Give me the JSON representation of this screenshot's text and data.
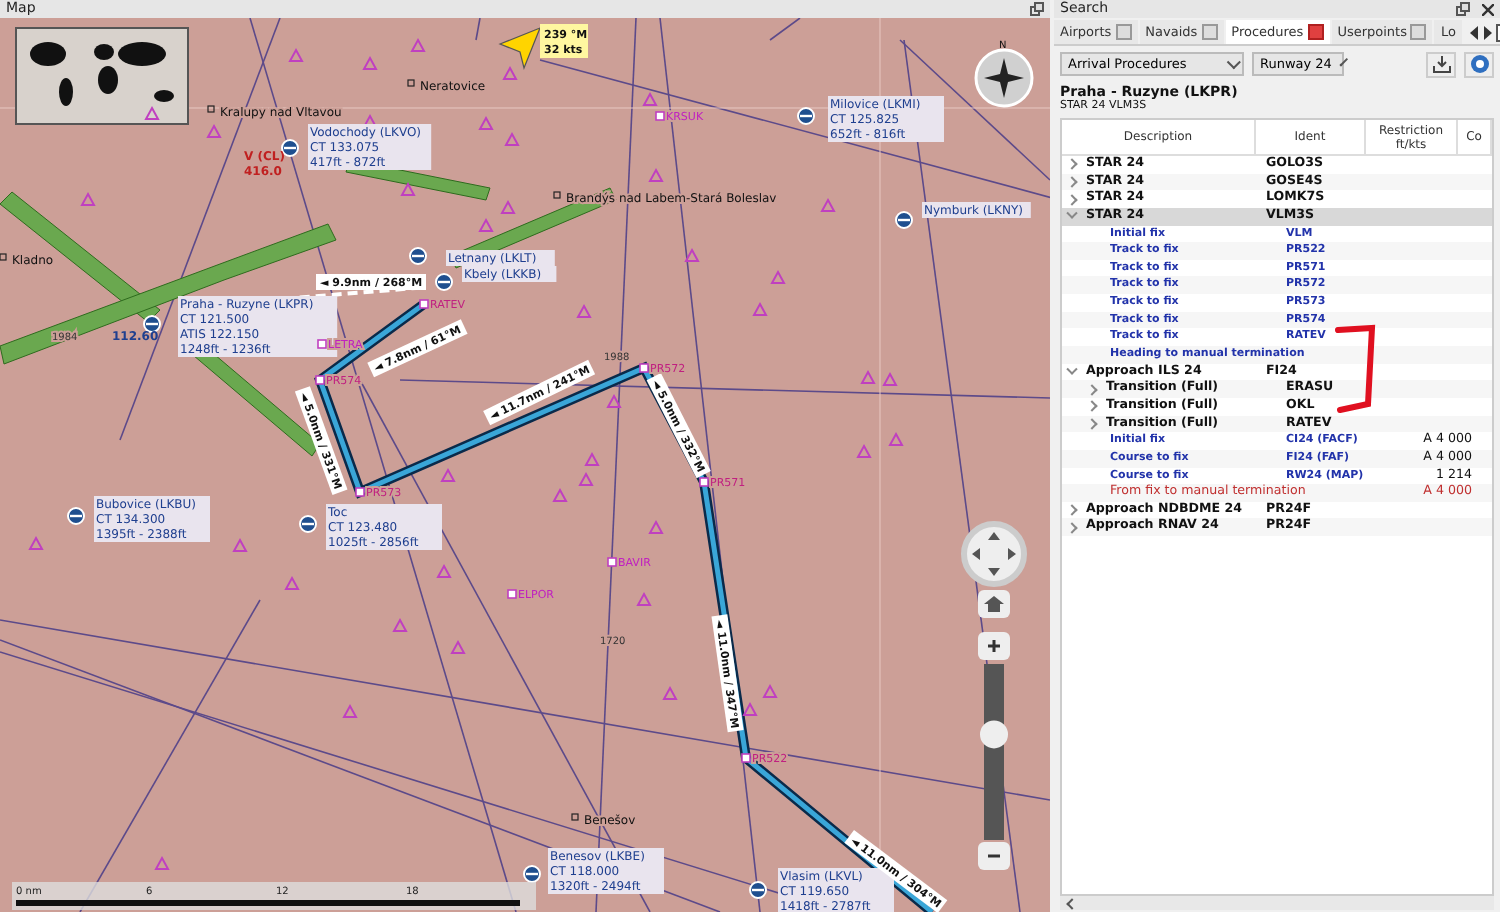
{
  "map": {
    "title": "Map",
    "aircraft": {
      "heading": "239 °M",
      "speed": "32 kts"
    },
    "places": [
      "Kralupy nad Vltavou",
      "Neratovice",
      "Kladno",
      "Brandýs nad Labem-Stará Boleslav",
      "Benešov"
    ],
    "airports": [
      {
        "name": "Vodochody (LKVO)",
        "lines": [
          "CT 133.075",
          "417ft - 872ft"
        ]
      },
      {
        "name": "Praha - Ruzyne (LKPR)",
        "lines": [
          "CT 121.500",
          "ATIS 122.150",
          "1248ft - 1236ft"
        ]
      },
      {
        "name": "Letnany (LKLT)"
      },
      {
        "name": "Kbely (LKKB)"
      },
      {
        "name": "Milovice (LKMI)",
        "lines": [
          "CT 125.825",
          "652ft - 816ft"
        ]
      },
      {
        "name": "Nymburk (LKNY)"
      },
      {
        "name": "Bubovice (LKBU)",
        "lines": [
          "CT 134.300",
          "1395ft - 2388ft"
        ]
      },
      {
        "name": "Toc",
        "lines": [
          "CT 123.480",
          "1025ft - 2856ft"
        ]
      },
      {
        "name": "Benesov (LKBE)",
        "lines": [
          "CT 118.000",
          "1320ft - 2494ft"
        ]
      },
      {
        "name": "Vlasim (LKVL)",
        "lines": [
          "CT 119.650",
          "1418ft - 2787ft"
        ]
      }
    ],
    "navaids": [
      {
        "name": "V (CL)",
        "freq": "416.0"
      },
      {
        "freq": "112.60"
      }
    ],
    "waypoints": [
      "RATEV",
      "PR574",
      "PR573",
      "PR572",
      "PR571",
      "PR522",
      "KRSUK",
      "BAVIR",
      "ELPOR",
      "LETRA"
    ],
    "legs": [
      "◄ 9.9nm / 268°M",
      "◄ 7.8nm / 61°M",
      "◄ 5.0nm / 331°M",
      "◄ 11.7nm / 241°M",
      "◄ 5.0nm / 332°M",
      "◄ 11.0nm / 347°M",
      "◄ 11.0nm / 304°M"
    ],
    "airway_labels": [
      "1984",
      "1988",
      "1720"
    ],
    "compass_label": "N",
    "scale": [
      "0 nm",
      "6",
      "12",
      "18"
    ],
    "zoom": {
      "level": 0.6
    }
  },
  "search": {
    "title": "Search",
    "tabs": [
      {
        "label": "Airports",
        "selected": false
      },
      {
        "label": "Navaids",
        "selected": false
      },
      {
        "label": "Procedures",
        "selected": true
      },
      {
        "label": "Userpoints",
        "selected": false
      },
      {
        "label": "Lo",
        "selected": false
      }
    ],
    "filter": "Arrival Procedures",
    "runway": "Runway 24",
    "airport": "Praha - Ruzyne (LKPR)",
    "procedure": "STAR 24 VLM3S",
    "columns": [
      "Description",
      "Ident",
      "Restriction ft/kts",
      "Co"
    ],
    "rows": [
      {
        "kind": "group",
        "description": "STAR 24",
        "ident": "GOLO3S",
        "expanded": false,
        "selected": false
      },
      {
        "kind": "group",
        "description": "STAR 24",
        "ident": "GOSE4S",
        "expanded": false,
        "selected": false
      },
      {
        "kind": "group",
        "description": "STAR 24",
        "ident": "LOMK7S",
        "expanded": false,
        "selected": false
      },
      {
        "kind": "group",
        "description": "STAR 24",
        "ident": "VLM3S",
        "expanded": true,
        "selected": true,
        "children": [
          {
            "kind": "leg",
            "description": "Initial fix",
            "ident": "VLM",
            "selected": false
          },
          {
            "kind": "leg",
            "description": "Track to fix",
            "ident": "PR522",
            "selected": false
          },
          {
            "kind": "leg",
            "description": "Track to fix",
            "ident": "PR571",
            "selected": false
          },
          {
            "kind": "leg",
            "description": "Track to fix",
            "ident": "PR572",
            "selected": false
          },
          {
            "kind": "leg",
            "description": "Track to fix",
            "ident": "PR573",
            "selected": false
          },
          {
            "kind": "leg",
            "description": "Track to fix",
            "ident": "PR574",
            "selected": false
          },
          {
            "kind": "leg",
            "description": "Track to fix",
            "ident": "RATEV",
            "selected": false
          },
          {
            "kind": "leg",
            "description": "Heading to manual termination",
            "selected": false
          }
        ]
      },
      {
        "kind": "group",
        "description": "Approach ILS 24",
        "ident": "FI24",
        "expanded": true,
        "selected": false,
        "children": [
          {
            "kind": "group",
            "description": "Transition (Full)",
            "ident": "ERASU",
            "expanded": false,
            "selected": false
          },
          {
            "kind": "group",
            "description": "Transition (Full)",
            "ident": "OKL",
            "expanded": false,
            "selected": false
          },
          {
            "kind": "group",
            "description": "Transition (Full)",
            "ident": "RATEV",
            "expanded": false,
            "selected": false
          },
          {
            "kind": "leg",
            "description": "Initial fix",
            "ident": "CI24 (FACF)",
            "restriction": "A 4 000",
            "selected": false
          },
          {
            "kind": "leg",
            "description": "Course to fix",
            "ident": "FI24 (FAF)",
            "restriction": "A 4 000",
            "selected": false
          },
          {
            "kind": "leg",
            "description": "Course to fix",
            "ident": "RW24 (MAP)",
            "restriction": "1 214",
            "selected": false
          },
          {
            "kind": "missed",
            "description": "From fix to manual termination",
            "restriction": "A 4 000",
            "selected": false
          }
        ]
      },
      {
        "kind": "group",
        "description": "Approach NDBDME 24",
        "ident": "PR24F",
        "expanded": false,
        "selected": false
      },
      {
        "kind": "group",
        "description": "Approach RNAV 24",
        "ident": "PR24F",
        "expanded": false,
        "selected": false
      }
    ]
  }
}
